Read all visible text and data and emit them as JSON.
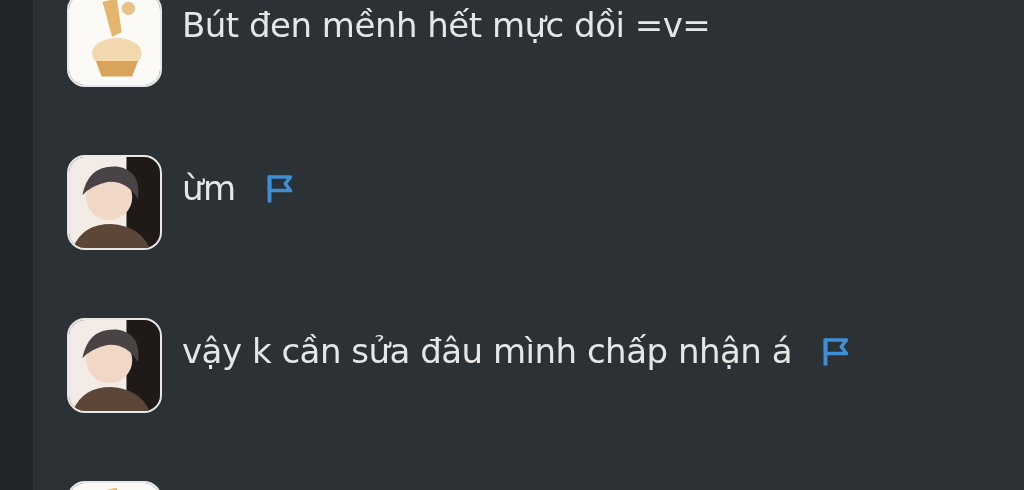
{
  "messages": [
    {
      "kind": "cartoon",
      "text": "Bút đen mềnh hết mực dồi =v=",
      "flagged": false
    },
    {
      "kind": "photo",
      "text": "ừm",
      "flagged": true
    },
    {
      "kind": "photo",
      "text": "vậy k cần sửa đâu mình chấp nhận á",
      "flagged": true
    },
    {
      "kind": "cartoon",
      "flagged": false
    }
  ]
}
